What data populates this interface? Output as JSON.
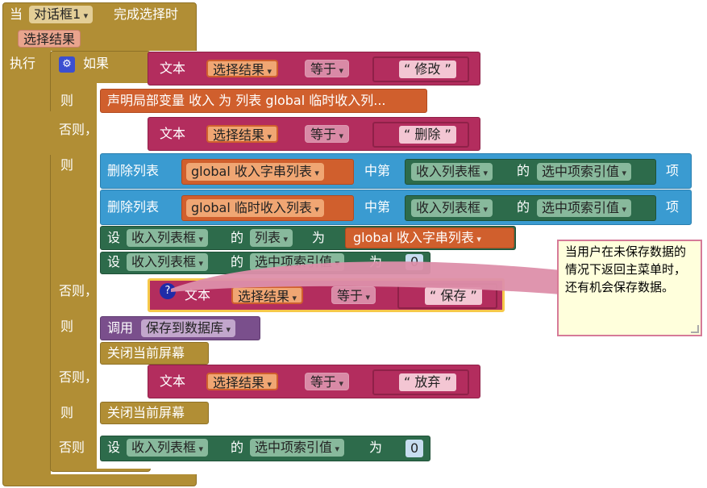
{
  "event": {
    "when": "当",
    "component": "对话框1",
    "event_name": "完成选择时",
    "param": "选择结果"
  },
  "do_label": "执行",
  "if_label": "如果",
  "then_label": "则",
  "elseif_label": "否则，如果",
  "else_label": "否则",
  "text_label": "文本",
  "compare_var": "选择结果",
  "compare_op": "等于",
  "cond1": "修改",
  "cond2": "删除",
  "cond3": "保存",
  "cond4": "放弃",
  "declare_local": "声明局部变量 收入 为 列表 global 临时收入列...",
  "remove_list_label": "删除列表",
  "list_string": "global 收入字串列表",
  "list_temp": "global 临时收入列表",
  "middle_label": "中第",
  "listbox": "收入列表框",
  "of_label": "的",
  "selected_index": "选中项索引值",
  "item_label": "项",
  "set_label": "设",
  "elements_prop": "列表",
  "to_label": "为",
  "list_string_get": "global 收入字串列表",
  "zero": "0",
  "call_label": "调用",
  "save_proc": "保存到数据库",
  "close_screen": "关闭当前屏幕",
  "comment_text": "当用户在未保存数据的情况下返回主菜单时，还有机会保存数据。",
  "colors": {
    "control": "#b18e35",
    "text": "#b32d5e",
    "list": "#3a9bd1",
    "component": "#2d6b4b",
    "variable": "#d05f2d",
    "procedure": "#7a4f8c"
  }
}
